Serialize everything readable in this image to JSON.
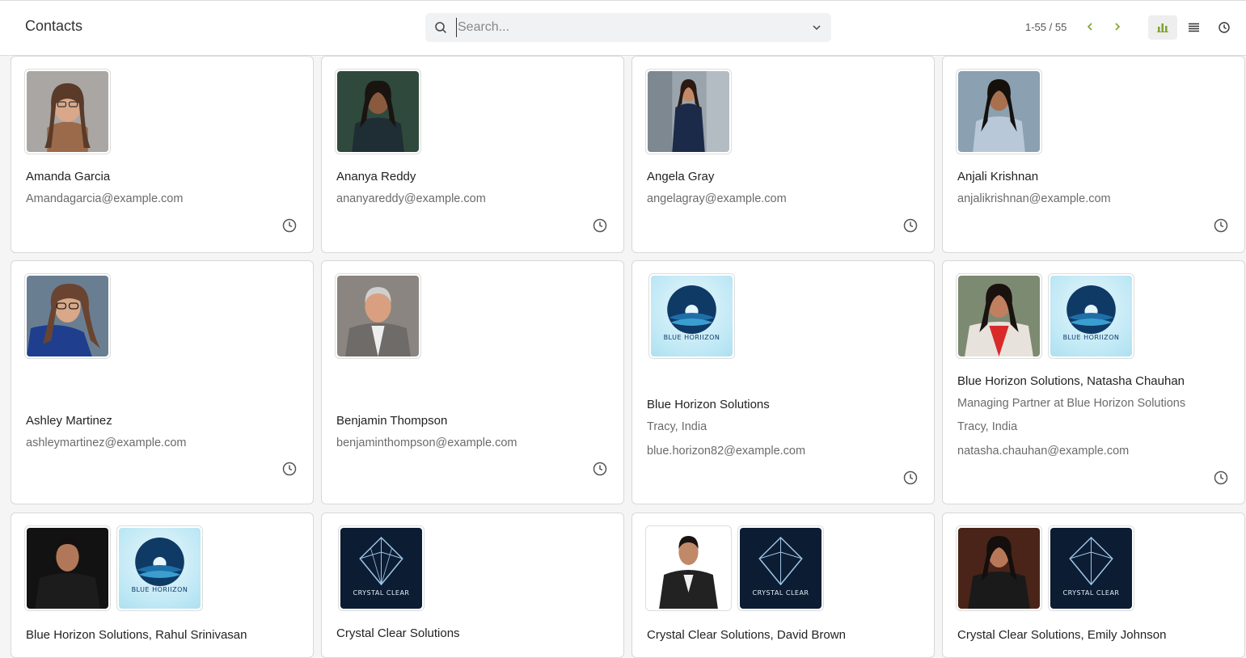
{
  "header": {
    "title": "Contacts",
    "search_placeholder": "Search...",
    "pager": "1-55 / 55"
  },
  "icons": {
    "search": "search-icon",
    "dropdown": "chevron-down-icon",
    "prev": "chevron-left-icon",
    "next": "chevron-right-icon",
    "kanban": "bar-chart-icon",
    "list": "list-icon",
    "activity": "clock-icon"
  },
  "colors": {
    "accent": "#7fa32b",
    "muted_text": "#6b6b6b"
  },
  "cards": [
    {
      "name": "Amanda Garcia",
      "email": "Amandagarcia@example.com"
    },
    {
      "name": "Ananya Reddy",
      "email": "ananyareddy@example.com"
    },
    {
      "name": "Angela Gray",
      "email": "angelagray@example.com"
    },
    {
      "name": "Anjali Krishnan",
      "email": "anjalikrishnan@example.com"
    },
    {
      "name": "Ashley Martinez",
      "email": "ashleymartinez@example.com"
    },
    {
      "name": "Benjamin Thompson",
      "email": "benjaminthompson@example.com"
    },
    {
      "name": "Blue Horizon Solutions",
      "location": "Tracy, India",
      "email": "blue.horizon82@example.com"
    },
    {
      "name": "Blue Horizon Solutions, Natasha Chauhan",
      "job": "Managing Partner at Blue Horizon Solutions",
      "location": "Tracy, India",
      "email": "natasha.chauhan@example.com"
    },
    {
      "name": "Blue Horizon Solutions, Rahul Srinivasan"
    },
    {
      "name": "Crystal Clear Solutions"
    },
    {
      "name": "Crystal Clear Solutions, David Brown"
    },
    {
      "name": "Crystal Clear Solutions, Emily Johnson"
    }
  ],
  "logos": {
    "blue_horizon": "BLUE HORIIZON",
    "crystal_clear": "CRYSTAL CLEAR"
  }
}
